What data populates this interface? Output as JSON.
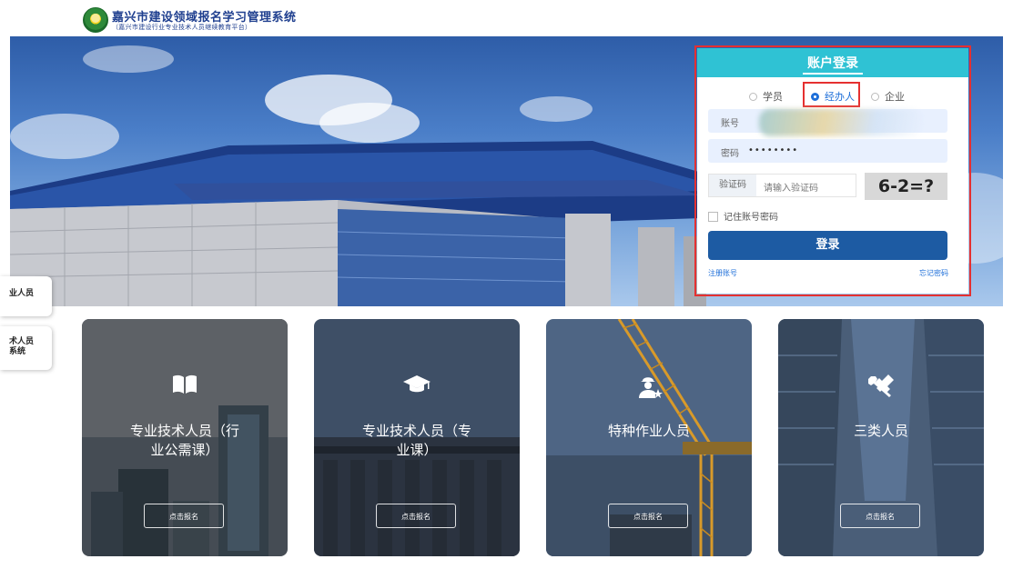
{
  "header": {
    "title": "嘉兴市建设领域报名学习管理系统",
    "subtitle": "（嘉兴市建设行业专业技术人员继续教育平台）"
  },
  "login": {
    "title": "账户登录",
    "roles": [
      {
        "label": "学员",
        "selected": false
      },
      {
        "label": "经办人",
        "selected": true
      },
      {
        "label": "企业",
        "selected": false
      }
    ],
    "account_label": "账号",
    "password_label": "密码",
    "password_value": "••••••••",
    "captcha_label": "验证码",
    "captcha_placeholder": "请输入验证码",
    "captcha_image_text": "6-2=?",
    "remember_label": "记住账号密码",
    "login_button": "登录",
    "register_link": "注册账号",
    "forgot_link": "忘记密码"
  },
  "side_tabs": [
    {
      "label": "业人员"
    },
    {
      "line1": "术人员",
      "line2": "系统"
    }
  ],
  "cards": [
    {
      "line1": "专业技术人员（行",
      "line2": "业公需课）",
      "button": "点击报名",
      "icon": "book-icon"
    },
    {
      "line1": "专业技术人员（专",
      "line2": "业课）",
      "button": "点击报名",
      "icon": "graduation-cap-icon"
    },
    {
      "line1": "特种作业人员",
      "line2": "",
      "button": "点击报名",
      "icon": "worker-icon"
    },
    {
      "line1": "三类人员",
      "line2": "",
      "button": "点击报名",
      "icon": "tools-icon"
    }
  ],
  "colors": {
    "accent_teal": "#2fc2d4",
    "primary_blue": "#1d5ba3",
    "highlight_red": "#e53030",
    "title_blue": "#1f3f8f"
  }
}
